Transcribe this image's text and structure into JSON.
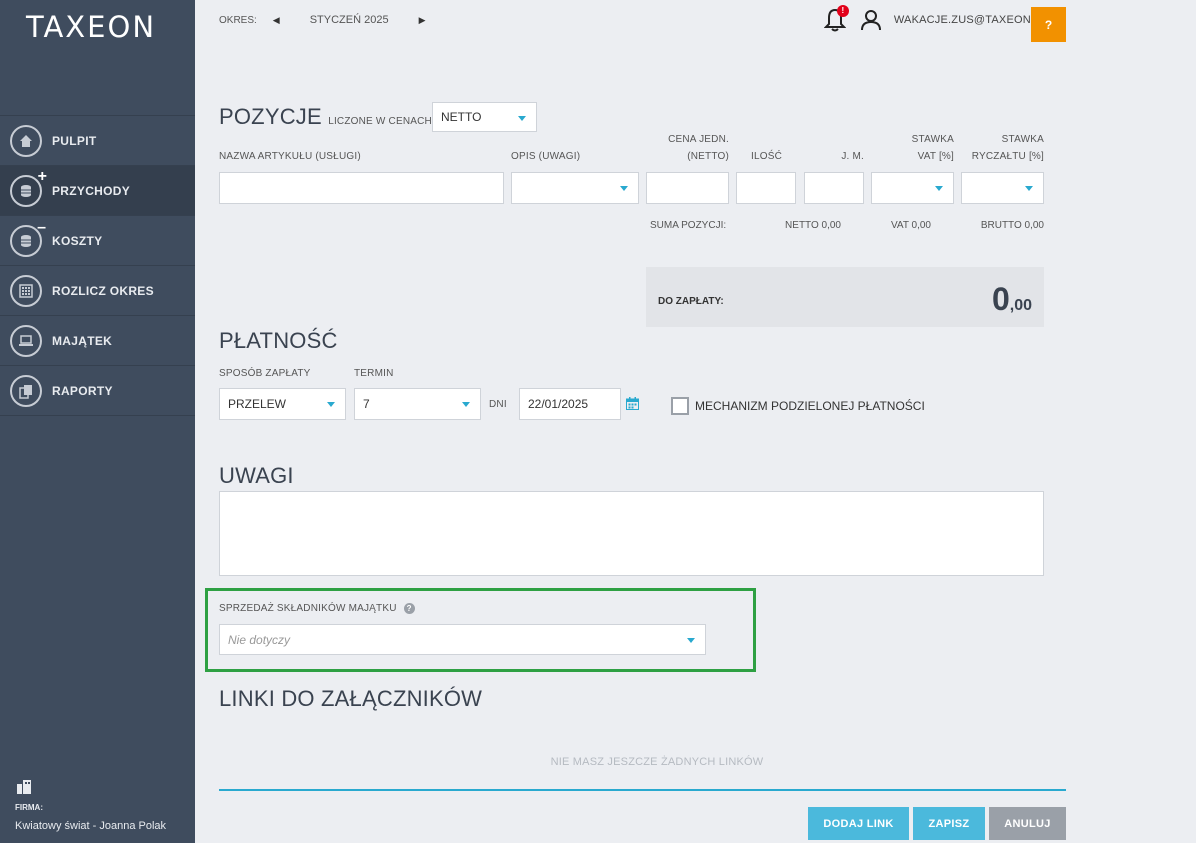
{
  "app": {
    "logo": "TAXEON"
  },
  "sidebar": {
    "items": [
      {
        "label": "PULPIT",
        "icon": "home-icon"
      },
      {
        "label": "PRZYCHODY",
        "icon": "coins-plus-icon"
      },
      {
        "label": "KOSZTY",
        "icon": "coins-minus-icon"
      },
      {
        "label": "ROZLICZ OKRES",
        "icon": "calculator-icon"
      },
      {
        "label": "MAJĄTEK",
        "icon": "laptop-icon"
      },
      {
        "label": "RAPORTY",
        "icon": "reports-icon"
      }
    ],
    "active": "PRZYCHODY",
    "firm_label": "FIRMA:",
    "firm_name": "Kwiatowy świat - Joanna Polak"
  },
  "header": {
    "period_label": "OKRES:",
    "period_value": "STYCZEŃ 2025",
    "notification_count": "!",
    "user_email": "WAKACJE.ZUS@TAXEON.PL",
    "help": "?"
  },
  "positions": {
    "title": "POZYCJE",
    "subtitle": "LICZONE W CENACH",
    "price_mode": "NETTO",
    "columns": {
      "name": "NAZWA ARTYKUŁU (USŁUGI)",
      "desc": "OPIS (UWAGI)",
      "unit_price_1": "CENA JEDN.",
      "unit_price_2": "(NETTO)",
      "qty": "ILOŚĆ",
      "unit": "J. M.",
      "vat_1": "STAWKA",
      "vat_2": "VAT [%]",
      "lump_1": "STAWKA",
      "lump_2": "RYCZAŁTU [%]"
    },
    "sum_label": "SUMA POZYCJI:",
    "netto": "NETTO  0,00",
    "vat": "VAT  0,00",
    "brutto": "BRUTTO  0,00",
    "to_pay_label": "DO ZAPŁATY:",
    "to_pay_int": "0",
    "to_pay_dec": ",00"
  },
  "payment": {
    "title": "PŁATNOŚĆ",
    "method_label": "SPOSÓB ZAPŁATY",
    "method_value": "PRZELEW",
    "term_label": "TERMIN",
    "term_value": "7",
    "days_label": "DNI",
    "date_value": "22/01/2025",
    "split_label": "MECHANIZM PODZIELONEJ PŁATNOŚCI"
  },
  "notes": {
    "title": "UWAGI"
  },
  "assets": {
    "label": "SPRZEDAŻ SKŁADNIKÓW MAJĄTKU",
    "placeholder": "Nie dotyczy"
  },
  "links": {
    "title": "LINKI DO ZAŁĄCZNIKÓW",
    "empty": "NIE MASZ JESZCZE ŻADNYCH LINKÓW"
  },
  "buttons": {
    "add_link": "DODAJ LINK",
    "save": "ZAPISZ",
    "cancel": "ANULUJ"
  },
  "colors": {
    "sidebar": "#3f4c5e",
    "accent": "#4bb9dc",
    "help": "#f29100",
    "highlight": "#2ea043"
  }
}
